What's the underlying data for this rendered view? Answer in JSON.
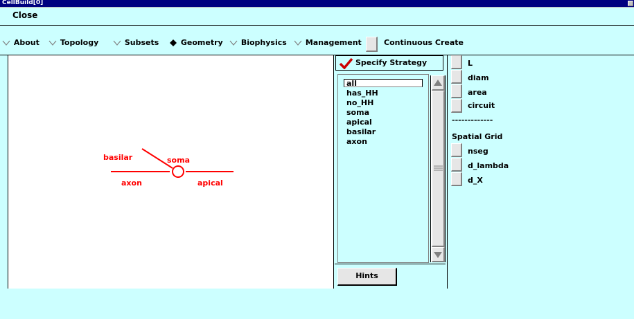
{
  "window": {
    "title": "CellBuild[0]"
  },
  "menubar": {
    "close_label": "Close"
  },
  "toolbar": {
    "items": [
      {
        "label": "About",
        "selected": false
      },
      {
        "label": "Topology",
        "selected": false
      },
      {
        "label": "Subsets",
        "selected": false
      },
      {
        "label": "Geometry",
        "selected": true
      },
      {
        "label": "Biophysics",
        "selected": false
      },
      {
        "label": "Management",
        "selected": false
      }
    ],
    "continuous_create_label": "Continuous Create"
  },
  "shape": {
    "labels": {
      "basilar": "basilar",
      "soma": "soma",
      "axon": "axon",
      "apical": "apical"
    },
    "color": "#ff0000"
  },
  "strategy": {
    "label": "Specify Strategy",
    "checked": true
  },
  "subsets": {
    "items": [
      "all",
      "has_HH",
      "no_HH",
      "soma",
      "apical",
      "basilar",
      "axon"
    ],
    "selected": "all"
  },
  "hints": {
    "label": "Hints"
  },
  "params": {
    "items": [
      "L",
      "diam",
      "area",
      "circuit"
    ],
    "divider": "-------------",
    "spatial_grid_label": "Spatial Grid",
    "grid_items": [
      "nseg",
      "d_lambda",
      "d_X"
    ]
  },
  "colors": {
    "background": "#ccffff",
    "titlebar": "#000080",
    "canvas": "#ffffff",
    "check": "#cc0000"
  }
}
